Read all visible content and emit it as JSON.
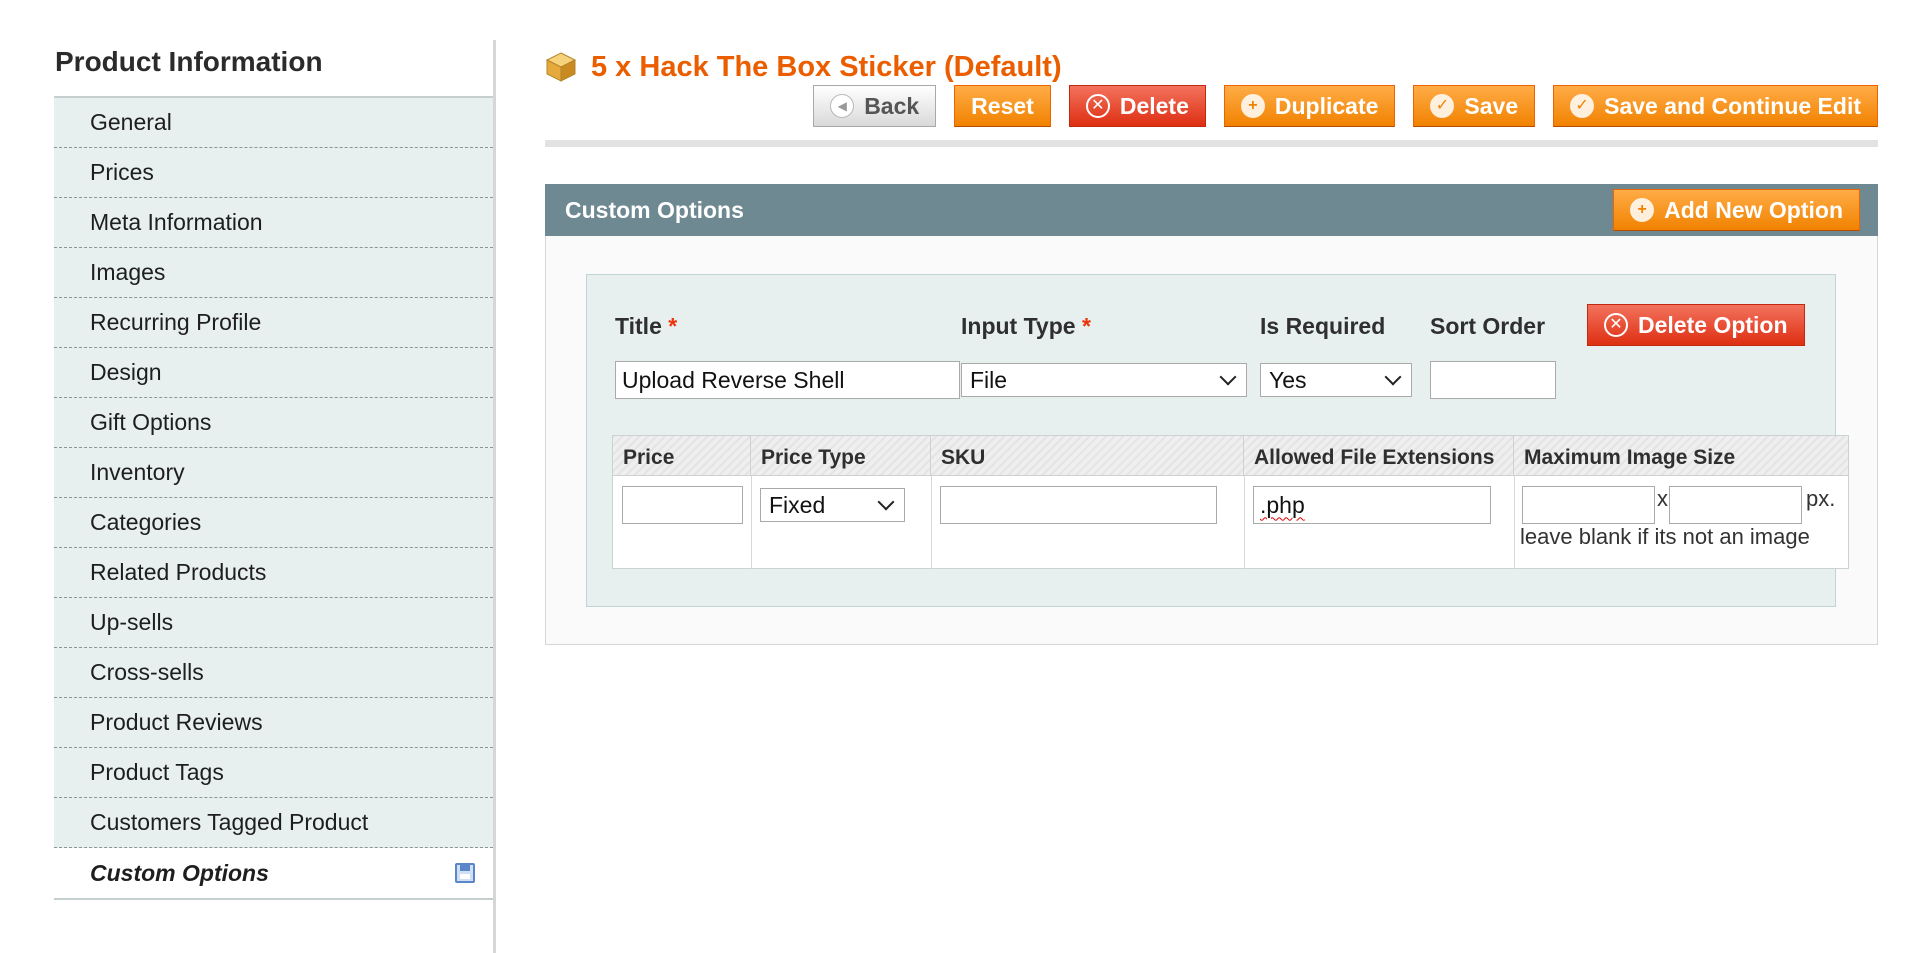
{
  "sidebar": {
    "title": "Product Information",
    "items": [
      {
        "label": "General"
      },
      {
        "label": "Prices"
      },
      {
        "label": "Meta Information"
      },
      {
        "label": "Images"
      },
      {
        "label": "Recurring Profile"
      },
      {
        "label": "Design"
      },
      {
        "label": "Gift Options"
      },
      {
        "label": "Inventory"
      },
      {
        "label": "Categories"
      },
      {
        "label": "Related Products"
      },
      {
        "label": "Up-sells"
      },
      {
        "label": "Cross-sells"
      },
      {
        "label": "Product Reviews"
      },
      {
        "label": "Product Tags"
      },
      {
        "label": "Customers Tagged Product"
      }
    ],
    "active_item": {
      "label": "Custom Options",
      "icon": "save-icon"
    }
  },
  "header": {
    "title": "5 x Hack The Box Sticker (Default)",
    "icon": "product-box-icon",
    "buttons": {
      "back": "Back",
      "reset": "Reset",
      "delete": "Delete",
      "duplicate": "Duplicate",
      "save": "Save",
      "save_continue": "Save and Continue Edit"
    }
  },
  "custom_options": {
    "section_title": "Custom Options",
    "add_button": "Add New Option",
    "option": {
      "title_label": "Title",
      "title_value": "Upload Reverse Shell",
      "input_type_label": "Input Type",
      "input_type_value": "File",
      "is_required_label": "Is Required",
      "is_required_value": "Yes",
      "sort_order_label": "Sort Order",
      "sort_order_value": "",
      "required_mark": "*",
      "delete_button": "Delete Option"
    },
    "table": {
      "headers": [
        "Price",
        "Price Type",
        "SKU",
        "Allowed File Extensions",
        "Maximum Image Size"
      ],
      "price_value": "",
      "price_type_value": "Fixed",
      "sku_value": "",
      "extensions_value": ".php",
      "width_value": "",
      "height_value": "",
      "x_text": "x",
      "px_text": "px.",
      "hint": "leave blank if its not an image"
    }
  },
  "colors": {
    "accent_orange": "#eb5e00",
    "button_orange": "#f18200",
    "button_red": "#de2f12",
    "fieldset_header": "#6f8992",
    "sidebar_bg": "#e7efef"
  }
}
